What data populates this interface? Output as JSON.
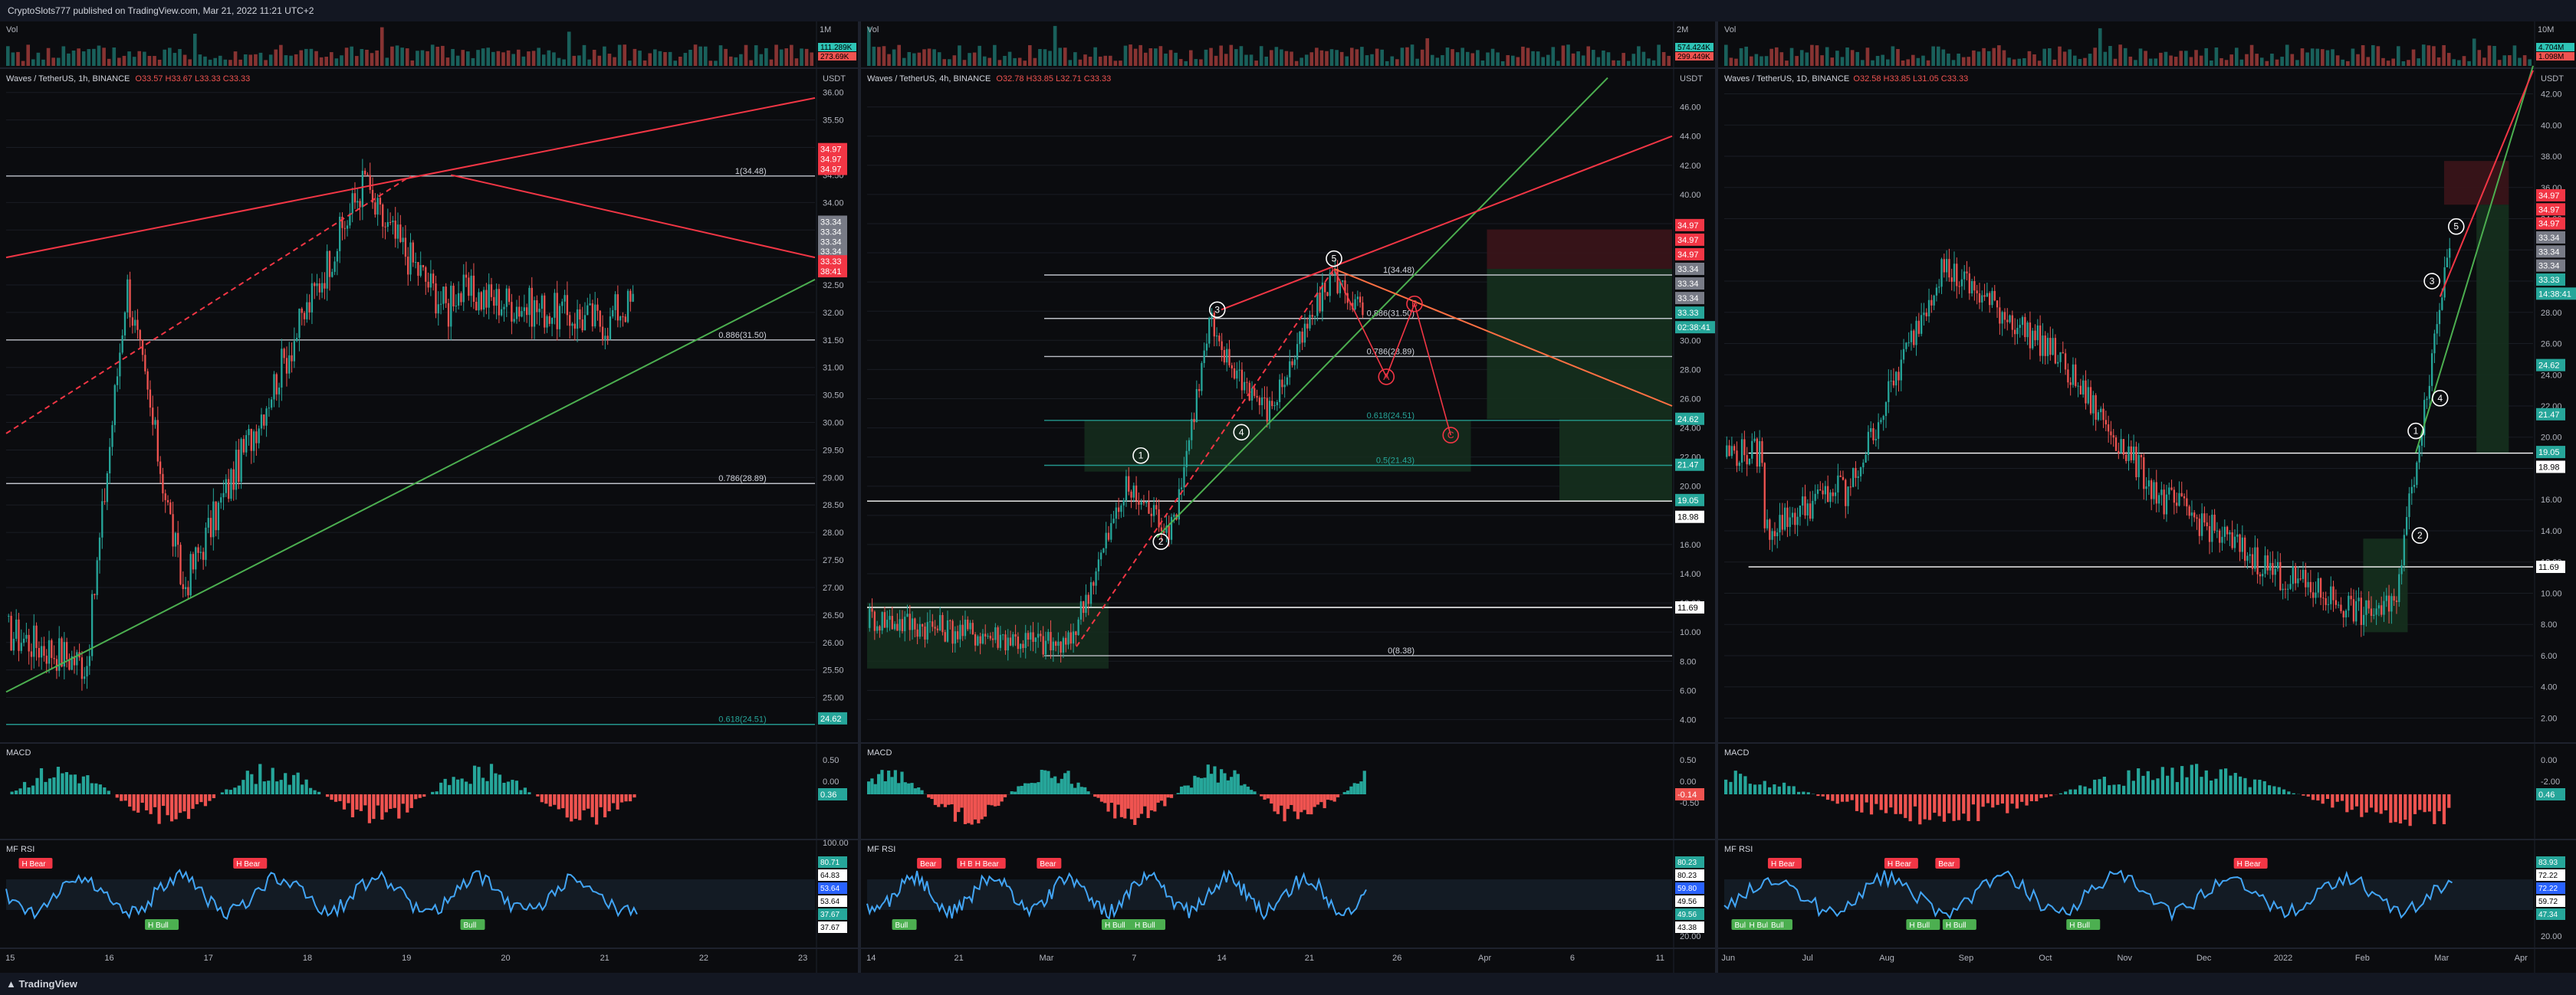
{
  "header": {
    "publisher": "CryptoSlots777 published on TradingView.com, Mar 21, 2022 11:21 UTC+2"
  },
  "footer": {
    "brand": "TradingView"
  },
  "colors": {
    "bg": "#0b0c0f",
    "grid": "#1a1d24",
    "text": "#b2b5be",
    "up": "#26a69a",
    "down": "#ef5350",
    "red_line": "#f23645",
    "green_line": "#4caf50",
    "fib_line": "#d1d4dc",
    "box_green": "#15301e",
    "box_red": "#3b1419"
  },
  "panels": [
    {
      "id": "p1",
      "symbol": "Waves / TetherUS, 1h, BINANCE",
      "ohlc": "O33.57 H33.67 L33.33 C33.33",
      "vol_label": "Vol",
      "vol_values": [
        "111.289K",
        "273.69K"
      ],
      "axis_unit": "USDT",
      "interval_label": "1M",
      "price_ticks": [
        "36.00",
        "35.50",
        "35.00",
        "34.50",
        "34.00",
        "33.50",
        "33.00",
        "32.50",
        "32.00",
        "31.50",
        "31.00",
        "30.50",
        "30.00",
        "29.50",
        "29.00",
        "28.50",
        "28.00",
        "27.50",
        "27.00",
        "26.50",
        "26.00",
        "25.50",
        "25.00"
      ],
      "price_range": [
        24.2,
        36.4
      ],
      "tags": [
        {
          "text": "34.97",
          "price": 34.97,
          "bg": "#f23645"
        },
        {
          "text": "34.97",
          "price": 34.79,
          "bg": "#f23645"
        },
        {
          "text": "34.97",
          "price": 34.61,
          "bg": "#f23645"
        },
        {
          "text": "33.34",
          "price": 33.65,
          "bg": "#787b86"
        },
        {
          "text": "33.34",
          "price": 33.47,
          "bg": "#787b86"
        },
        {
          "text": "33.34",
          "price": 33.29,
          "bg": "#787b86"
        },
        {
          "text": "33.34",
          "price": 33.11,
          "bg": "#787b86"
        },
        {
          "text": "33.33",
          "price": 32.93,
          "bg": "#f23645"
        },
        {
          "text": "38:41",
          "price": 32.75,
          "bg": "#f23645"
        },
        {
          "text": "24.62",
          "price": 24.62,
          "bg": "#26a69a"
        }
      ],
      "fib_levels": [
        {
          "label": "1(34.48)",
          "price": 34.48
        },
        {
          "label": "0.886(31.50)",
          "price": 31.5
        },
        {
          "label": "0.786(28.89)",
          "price": 28.89
        },
        {
          "label": "0.618(24.51)",
          "price": 24.51
        }
      ],
      "time_labels": [
        "15",
        "16",
        "17",
        "18",
        "19",
        "20",
        "21",
        "22",
        "23"
      ],
      "macd": {
        "label": "MACD",
        "ticks": [
          "0.50",
          "0.00"
        ],
        "tag": "0.36"
      },
      "rsi": {
        "label": "MF RSI",
        "ticks": [
          "100.00"
        ],
        "tags": [
          "80.71",
          "64.83",
          "53.64",
          "53.64",
          "37.67",
          "37.67"
        ],
        "signals": [
          {
            "text": "H Bear",
            "t": 0.02
          },
          {
            "text": "H Bear",
            "t": 0.36
          },
          {
            "text": "H Bull",
            "t": 0.22
          },
          {
            "text": "Bull",
            "t": 0.72
          }
        ]
      }
    },
    {
      "id": "p2",
      "symbol": "Waves / TetherUS, 4h, BINANCE",
      "ohlc": "O32.78 H33.85 L32.71 C33.33",
      "vol_label": "Vol",
      "vol_values": [
        "574.424K",
        "299.449K"
      ],
      "axis_unit": "USDT",
      "interval_label": "2M",
      "price_ticks": [
        "46.00",
        "44.00",
        "42.00",
        "40.00",
        "38.00",
        "36.00",
        "34.00",
        "32.00",
        "30.00",
        "28.00",
        "26.00",
        "24.00",
        "22.00",
        "20.00",
        "18.00",
        "16.00",
        "14.00",
        "12.00",
        "10.00",
        "8.00",
        "6.00",
        "4.00"
      ],
      "price_range": [
        2.5,
        48.5
      ],
      "tags": [
        {
          "text": "34.97",
          "price": 37.9,
          "bg": "#f23645"
        },
        {
          "text": "34.97",
          "price": 36.9,
          "bg": "#f23645"
        },
        {
          "text": "34.97",
          "price": 35.9,
          "bg": "#f23645"
        },
        {
          "text": "33.34",
          "price": 34.9,
          "bg": "#787b86"
        },
        {
          "text": "33.34",
          "price": 33.9,
          "bg": "#787b86"
        },
        {
          "text": "33.34",
          "price": 32.9,
          "bg": "#787b86"
        },
        {
          "text": "33.33",
          "price": 31.9,
          "bg": "#26a69a"
        },
        {
          "text": "02:38:41",
          "price": 30.9,
          "bg": "#26a69a"
        },
        {
          "text": "24.62",
          "price": 24.62,
          "bg": "#26a69a"
        },
        {
          "text": "21.47",
          "price": 21.47,
          "bg": "#26a69a"
        },
        {
          "text": "19.05",
          "price": 19.05,
          "bg": "#26a69a"
        },
        {
          "text": "18.98",
          "price": 17.9,
          "bg": "#ffffff"
        },
        {
          "text": "11.69",
          "price": 11.69,
          "bg": "#ffffff"
        }
      ],
      "fib_levels": [
        {
          "label": "1(34.48)",
          "price": 34.48
        },
        {
          "label": "0.886(31.50)",
          "price": 31.5
        },
        {
          "label": "0.786(28.89)",
          "price": 28.89
        },
        {
          "label": "0.618(24.51)",
          "price": 24.51
        },
        {
          "label": "0.5(21.43)",
          "price": 21.43
        },
        {
          "label": "0(8.38)",
          "price": 8.38
        }
      ],
      "waves": [
        {
          "text": "1",
          "t": 0.34,
          "price": 22.1
        },
        {
          "text": "2",
          "t": 0.365,
          "price": 16.2
        },
        {
          "text": "3",
          "t": 0.435,
          "price": 32.1
        },
        {
          "text": "4",
          "t": 0.465,
          "price": 23.7
        },
        {
          "text": "5",
          "t": 0.58,
          "price": 35.6
        },
        {
          "text": "A",
          "t": 0.645,
          "price": 27.5
        },
        {
          "text": "B",
          "t": 0.68,
          "price": 32.5
        },
        {
          "text": "C",
          "t": 0.725,
          "price": 23.5
        }
      ],
      "time_labels": [
        "14",
        "21",
        "Mar",
        "7",
        "14",
        "21",
        "26",
        "Apr",
        "6",
        "11"
      ],
      "macd": {
        "label": "MACD",
        "ticks": [
          "0.50",
          "0.00",
          "-0.50"
        ],
        "tag": "-0.14"
      },
      "rsi": {
        "label": "MF RSI",
        "ticks": [
          "20.00"
        ],
        "tags": [
          "80.23",
          "80.23",
          "59.80",
          "49.56",
          "49.56",
          "43.38"
        ],
        "signals": [
          {
            "text": "Bear",
            "t": 0.1
          },
          {
            "text": "H Bear",
            "t": 0.18
          },
          {
            "text": "H Bear",
            "t": 0.21
          },
          {
            "text": "Bear",
            "t": 0.34
          },
          {
            "text": "Bull",
            "t": 0.05
          },
          {
            "text": "H Bull",
            "t": 0.47
          },
          {
            "text": "H Bull",
            "t": 0.53
          }
        ]
      }
    },
    {
      "id": "p3",
      "symbol": "Waves / TetherUS, 1D, BINANCE",
      "ohlc": "O32.58 H33.85 L31.05 C33.33",
      "vol_label": "Vol",
      "vol_values": [
        "4.704M",
        "1.098M"
      ],
      "axis_unit": "USDT",
      "interval_label": "10M",
      "price_ticks": [
        "42.00",
        "40.00",
        "38.00",
        "36.00",
        "34.00",
        "32.00",
        "30.00",
        "28.00",
        "26.00",
        "24.00",
        "22.00",
        "20.00",
        "18.00",
        "16.00",
        "14.00",
        "12.00",
        "10.00",
        "8.00",
        "6.00",
        "4.00",
        "2.00"
      ],
      "price_range": [
        0.5,
        43.5
      ],
      "tags": [
        {
          "text": "34.97",
          "price": 35.5,
          "bg": "#f23645"
        },
        {
          "text": "34.97",
          "price": 34.6,
          "bg": "#f23645"
        },
        {
          "text": "34.97",
          "price": 33.7,
          "bg": "#f23645"
        },
        {
          "text": "33.34",
          "price": 32.8,
          "bg": "#787b86"
        },
        {
          "text": "33.34",
          "price": 31.9,
          "bg": "#787b86"
        },
        {
          "text": "33.34",
          "price": 31.0,
          "bg": "#787b86"
        },
        {
          "text": "33.33",
          "price": 30.1,
          "bg": "#26a69a"
        },
        {
          "text": "14:38:41",
          "price": 29.2,
          "bg": "#26a69a"
        },
        {
          "text": "24.62",
          "price": 24.62,
          "bg": "#26a69a"
        },
        {
          "text": "21.47",
          "price": 21.47,
          "bg": "#26a69a"
        },
        {
          "text": "19.05",
          "price": 19.05,
          "bg": "#26a69a"
        },
        {
          "text": "18.98",
          "price": 18.1,
          "bg": "#ffffff"
        },
        {
          "text": "11.69",
          "price": 11.69,
          "bg": "#ffffff"
        }
      ],
      "fib_levels": [],
      "waves": [
        {
          "text": "1",
          "t": 0.855,
          "price": 20.4
        },
        {
          "text": "2",
          "t": 0.86,
          "price": 13.7
        },
        {
          "text": "3",
          "t": 0.875,
          "price": 30.0
        },
        {
          "text": "4",
          "t": 0.885,
          "price": 22.5
        },
        {
          "text": "5",
          "t": 0.905,
          "price": 33.5
        }
      ],
      "time_labels": [
        "Jun",
        "Jul",
        "Aug",
        "Sep",
        "Oct",
        "Nov",
        "Dec",
        "2022",
        "Feb",
        "Mar",
        "Apr"
      ],
      "macd": {
        "label": "MACD",
        "ticks": [
          "0.00",
          "-2.00"
        ],
        "tag": "0.46"
      },
      "rsi": {
        "label": "MF RSI",
        "ticks": [
          "20.00"
        ],
        "tags": [
          "83.93",
          "72.22",
          "72.22",
          "59.72",
          "47.34"
        ],
        "signals": [
          {
            "text": "H Bear",
            "t": 0.06
          },
          {
            "text": "H Bear",
            "t": 0.22
          },
          {
            "text": "Bear",
            "t": 0.29
          },
          {
            "text": "H Bear",
            "t": 0.7
          },
          {
            "text": "Bull",
            "t": 0.01
          },
          {
            "text": "H Bull",
            "t": 0.03
          },
          {
            "text": "H Bull",
            "t": 0.25
          },
          {
            "text": "H Bull",
            "t": 0.3
          },
          {
            "text": "H Bull",
            "t": 0.47
          },
          {
            "text": "Bull",
            "t": 0.06
          }
        ]
      }
    }
  ]
}
